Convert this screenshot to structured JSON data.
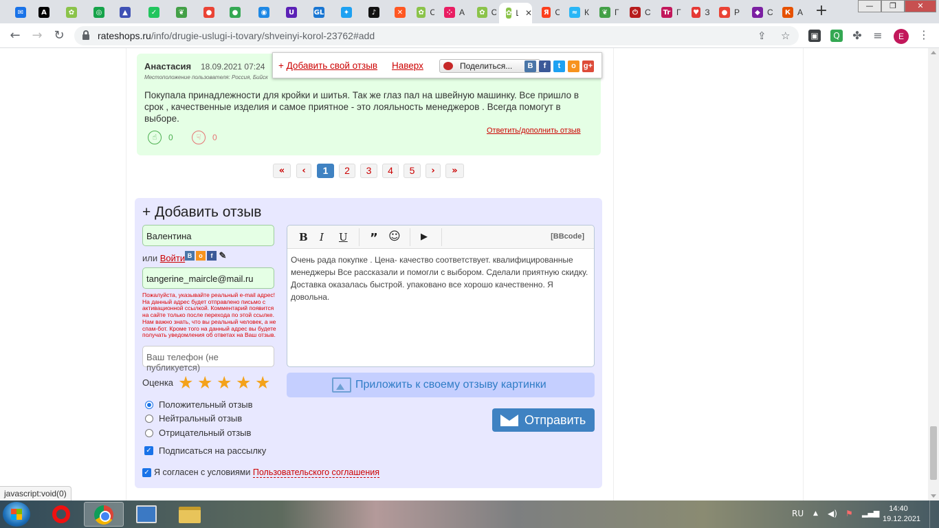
{
  "browser": {
    "tabs": [
      {
        "icon": "mail-icon",
        "color": "#1a73e8",
        "glyph": "✉",
        "label": ""
      },
      {
        "icon": "a-icon",
        "color": "#000000",
        "glyph": "A",
        "label": ""
      },
      {
        "icon": "site-icon",
        "color": "#8bc34a",
        "glyph": "✿",
        "label": ""
      },
      {
        "icon": "target-icon",
        "color": "#16a34a",
        "glyph": "◎",
        "label": ""
      },
      {
        "icon": "flask-icon",
        "color": "#3f51b5",
        "glyph": "▲",
        "label": ""
      },
      {
        "icon": "check-icon",
        "color": "#22c55e",
        "glyph": "✓",
        "label": ""
      },
      {
        "icon": "leaf-icon",
        "color": "#43a047",
        "glyph": "❦",
        "label": ""
      },
      {
        "icon": "pin-icon",
        "color": "#ea4335",
        "glyph": "●",
        "label": ""
      },
      {
        "icon": "maps-icon",
        "color": "#34a853",
        "glyph": "●",
        "label": ""
      },
      {
        "icon": "spiral-icon",
        "color": "#1e88e5",
        "glyph": "◉",
        "label": ""
      },
      {
        "icon": "shield-icon",
        "color": "#5b21b6",
        "glyph": "U",
        "label": ""
      },
      {
        "icon": "gl-icon",
        "color": "#1976d2",
        "glyph": "GL",
        "label": ""
      },
      {
        "icon": "twitter-icon",
        "color": "#1da1f2",
        "glyph": "✦",
        "label": ""
      },
      {
        "icon": "tiktok-icon",
        "color": "#111111",
        "glyph": "♪",
        "label": ""
      },
      {
        "icon": "x-icon",
        "color": "#ff5722",
        "glyph": "✕",
        "label": ""
      },
      {
        "icon": "site-icon",
        "color": "#8bc34a",
        "glyph": "✿",
        "label": "С"
      },
      {
        "icon": "dots-icon",
        "color": "#e91e63",
        "glyph": "⁘",
        "label": "А"
      },
      {
        "icon": "site-icon",
        "color": "#8bc34a",
        "glyph": "✿",
        "label": "С"
      },
      {
        "icon": "site-icon",
        "color": "#8bc34a",
        "glyph": "✿",
        "label": "Ш",
        "active": true
      },
      {
        "icon": "yandex-icon",
        "color": "#fc3f1d",
        "glyph": "Я",
        "label": "С"
      },
      {
        "icon": "wave-icon",
        "color": "#29b6f6",
        "glyph": "≈",
        "label": "К"
      },
      {
        "icon": "leaf-icon",
        "color": "#43a047",
        "glyph": "❦",
        "label": "Г"
      },
      {
        "icon": "power-icon",
        "color": "#b71c1c",
        "glyph": "⏻",
        "label": "С"
      },
      {
        "icon": "tr-icon",
        "color": "#c2185b",
        "glyph": "Tr",
        "label": "Г"
      },
      {
        "icon": "heart-icon",
        "color": "#e53935",
        "glyph": "♥",
        "label": "З"
      },
      {
        "icon": "pin-icon",
        "color": "#ea4335",
        "glyph": "●",
        "label": "Р"
      },
      {
        "icon": "diamond-icon",
        "color": "#7b1fa2",
        "glyph": "◆",
        "label": "С"
      },
      {
        "icon": "k-icon",
        "color": "#e65100",
        "glyph": "К",
        "label": "А"
      }
    ],
    "url_host": "rateshops.ru",
    "url_path": "/info/drugie-uslugi-i-tovary/shveinyi-korol-23762#add",
    "profile_initial": "E"
  },
  "review": {
    "author": "Анастасия",
    "date": "18.09.2021 07:24",
    "location": "Местоположение пользователя: Россия, Бийск",
    "text": "Покупала принадлежности для кройки и шитья. Так же глаз пал на швейную машинку. Все пришло в срок , качественные изделия и самое приятное - это лояльность менеджеров . Всегда помогут в выборе.",
    "reply_link": "Ответить/дополнить отзыв",
    "likes": "0",
    "dislikes": "0"
  },
  "popup": {
    "add_link": "Добавить свой отзыв",
    "top_link": "Наверх",
    "share_label": "Поделиться..."
  },
  "pagination": {
    "first": "«",
    "prev": "‹",
    "pages": [
      "1",
      "2",
      "3",
      "4",
      "5"
    ],
    "next": "›",
    "last": "»",
    "active": "1"
  },
  "form": {
    "title": "Добавить отзыв",
    "name_value": "Валентина",
    "or_label": "или",
    "login_link": "Войти",
    "email_value": "tangerine_maircle@mail.ru",
    "warning": "Пожалуйста, указывайте реальный e-mail адрес! На данный адрес будет отправлено письмо с активационной ссылкой. Комментарий появится на сайте только после перехода по этой ссылке. Нам важно знать, что вы реальный человек, а не спам-бот. Кроме того на данный адрес вы будете получать уведомления об ответах на Ваш отзыв.",
    "phone_placeholder": "Ваш телефон (не публикуется)",
    "rating_label": "Оценка",
    "rating": 5,
    "radio_options": [
      "Положительный отзыв",
      "Нейтральный отзыв",
      "Отрицательный отзыв"
    ],
    "radio_selected": 0,
    "subscribe_label": "Подписаться на рассылку",
    "agree_label": "Я согласен с условиями",
    "agree_link": "Пользовательского соглашения",
    "bbcode_label": "[BBcode]",
    "review_text": "Очень рада покупке . Цена- качество соответствует. квалифицированные менеджеры Все рассказали и помогли с выбором. Сделали приятную скидку. Доставка оказалась быстрой. упаковано все хорошо  качественно. Я довольна.",
    "attach_label": "Приложить к своему отзыву картинки",
    "send_label": "Отправить"
  },
  "status_url": "javascript:void(0)",
  "taskbar": {
    "lang": "RU",
    "time": "14:40",
    "date": "19.12.2021"
  }
}
